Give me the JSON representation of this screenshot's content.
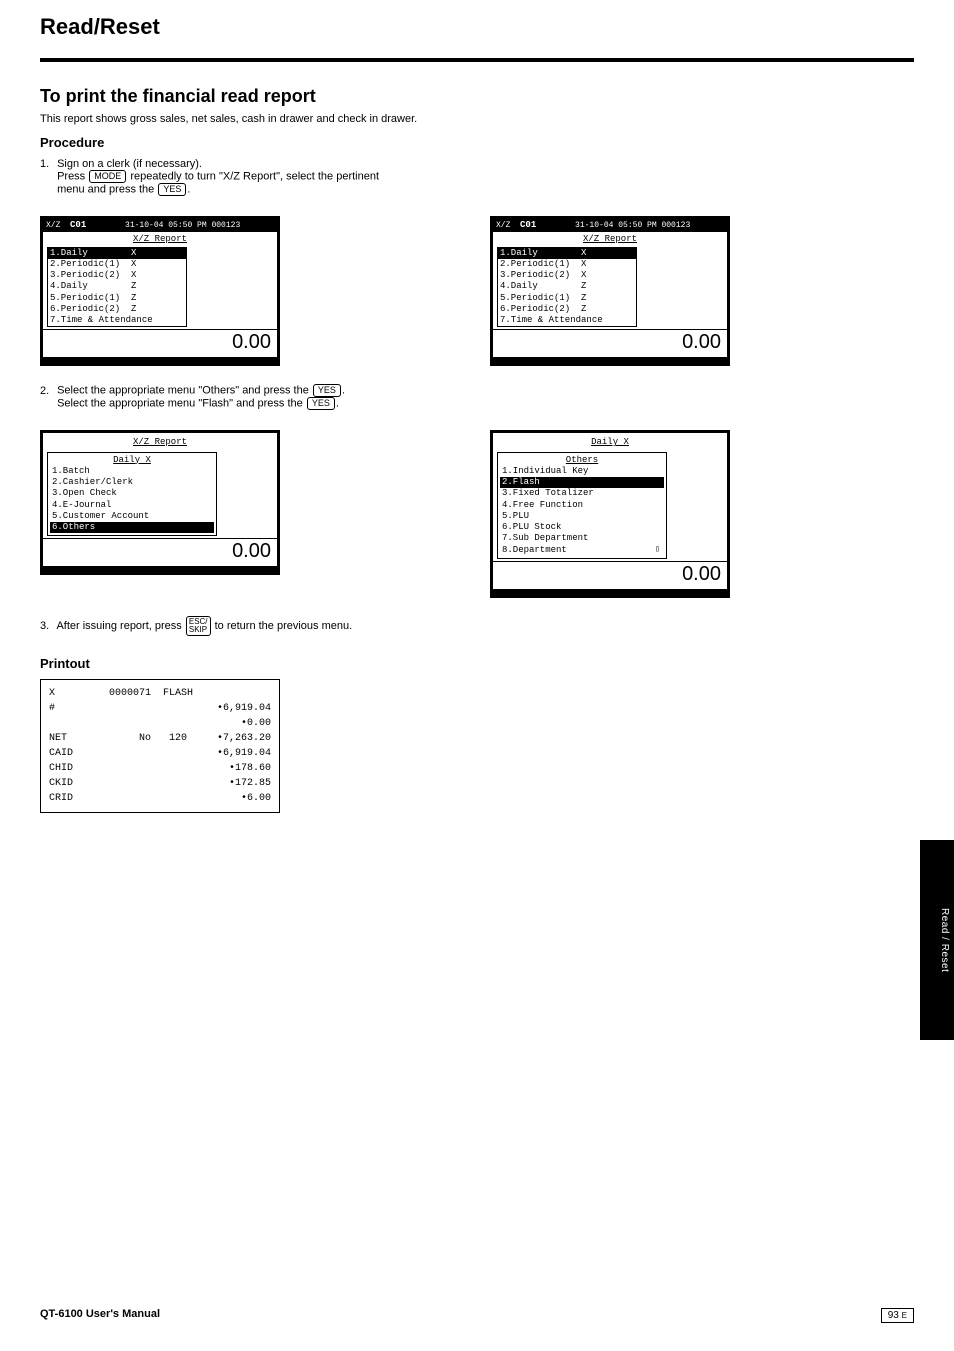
{
  "page_title": "Read/Reset",
  "section_title": "To print the financial read report",
  "section_desc": "This report shows gross sales, net sales, cash in drawer and check in drawer.",
  "procedure_heading": "Procedure",
  "step1": {
    "text_a": "Sign on a clerk (if necessary).",
    "text_b": "Press",
    "text_c": "repeatedly to turn \"X/Z Report\", select the pertinent",
    "text_d": "menu and press the"
  },
  "step2": {
    "text_a": "Select the appropriate menu \"Others\" and press the",
    "text_b": "Select the appropriate menu \"Flash\" and press the"
  },
  "step3": "After issuing report, press",
  "step3_b": "to return the previous menu.",
  "keys": {
    "mode": "MODE",
    "yes": "YES",
    "esc": "ESC/\nSKIP"
  },
  "lcd_statusbar": {
    "mode": "X/Z",
    "clerk": "C01",
    "datetime": "31-10-04 05:50 PM 000123"
  },
  "menu_main_title": "X/Z Report",
  "menu_main_items": [
    "1.Daily        X",
    "2.Periodic(1)  X",
    "3.Periodic(2)  X",
    "4.Daily        Z",
    "5.Periodic(1)  Z",
    "6.Periodic(2)  Z",
    "7.Time & Attendance"
  ],
  "big_total": "0.00",
  "daily_x_title": "Daily X",
  "daily_x_left_items": [
    "1.Batch",
    "2.Cashier/Clerk",
    "3.Open Check",
    "4.E-Journal",
    "5.Customer Account",
    "6.Others"
  ],
  "others_title": "Others",
  "daily_x_right_items": [
    "1.Individual Key",
    "2.Flash",
    "3.Fixed Totalizer",
    "4.Free Function",
    "5.PLU",
    "6.PLU Stock",
    "7.Sub Department",
    "8.Department"
  ],
  "printout_heading": "Printout",
  "receipt": {
    "rows": [
      {
        "left": "X         0000071  FLASH",
        "right": ""
      },
      {
        "left": "",
        "right": ""
      },
      {
        "left": "#",
        "right": "•6,919.04"
      },
      {
        "left": "",
        "right": "•0.00"
      },
      {
        "left": "",
        "right": ""
      },
      {
        "left": "NET            No   120",
        "right": "•7,263.20"
      },
      {
        "left": "CAID",
        "right": "•6,919.04"
      },
      {
        "left": "CHID",
        "right": "•178.60"
      },
      {
        "left": "CKID",
        "right": "•172.85"
      },
      {
        "left": "CRID",
        "right": "•6.00"
      }
    ]
  },
  "side_tab": "Read / Reset",
  "footer_model": "QT-6100 User's Manual",
  "footer_page": "93",
  "e_caption": "E"
}
